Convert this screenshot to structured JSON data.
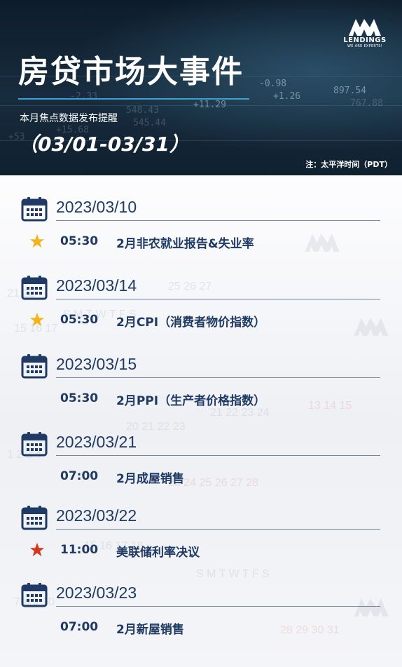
{
  "header": {
    "title": "房贷市场大事件",
    "subtitle": "本月焦点数据发布提醒",
    "range": "（03/01-03/31）",
    "note": "注：太平洋时间（PDT）",
    "ticker_text": [
      "-0.98",
      "+1.26",
      "897.54",
      "+11.29",
      "548.43",
      "767.88",
      "545.44",
      "+15.68",
      "-2.33",
      "+53"
    ]
  },
  "logo": {
    "name": "LENDINGS",
    "tagline": "WE ARE EXPERTS!"
  },
  "colors": {
    "primary": "#1f3a64",
    "accent_blue": "#3fa0d0",
    "star_gold": "#f2b61c",
    "star_red": "#d13a1f"
  },
  "events": [
    {
      "date": "2023/03/10",
      "time": "05:30",
      "description": "2月非农就业报告&失业率",
      "star": "gold"
    },
    {
      "date": "2023/03/14",
      "time": "05:30",
      "description": "2月CPI（消费者物价指数）",
      "star": "gold"
    },
    {
      "date": "2023/03/15",
      "time": "05:30",
      "description": "2月PPI（生产者价格指数）",
      "star": "none"
    },
    {
      "date": "2023/03/21",
      "time": "07:00",
      "description": "2月成屋销售",
      "star": "none"
    },
    {
      "date": "2023/03/22",
      "time": "11:00",
      "description": "美联储利率决议",
      "star": "red"
    },
    {
      "date": "2023/03/23",
      "time": "07:00",
      "description": "2月新屋销售",
      "star": "none"
    }
  ]
}
